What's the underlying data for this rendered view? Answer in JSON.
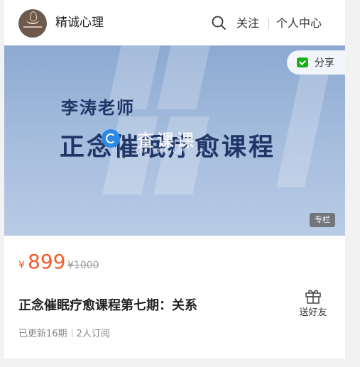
{
  "header": {
    "brand": "精诚心理",
    "follow_label": "关注",
    "personal_center_label": "个人中心"
  },
  "banner": {
    "line1": "李涛老师",
    "line2": "正念催眠疗愈课程",
    "watermark_text": "查课课",
    "watermark_sub": "CHA.YOKE.COM",
    "share_label": "分享",
    "badge": "专栏"
  },
  "course": {
    "currency": "¥",
    "price": "899",
    "original_price": "¥1000",
    "title": "正念催眠疗愈课程第七期：关系",
    "gift_label": "送好友",
    "updated": "已更新16期",
    "subscribers": "2人订阅"
  },
  "colors": {
    "accent": "#f25c2a",
    "banner_text": "#1f3667",
    "share_green": "#1aad19"
  },
  "icons": {
    "search": "search-icon",
    "share": "wechat-icon",
    "gift": "gift-icon"
  }
}
